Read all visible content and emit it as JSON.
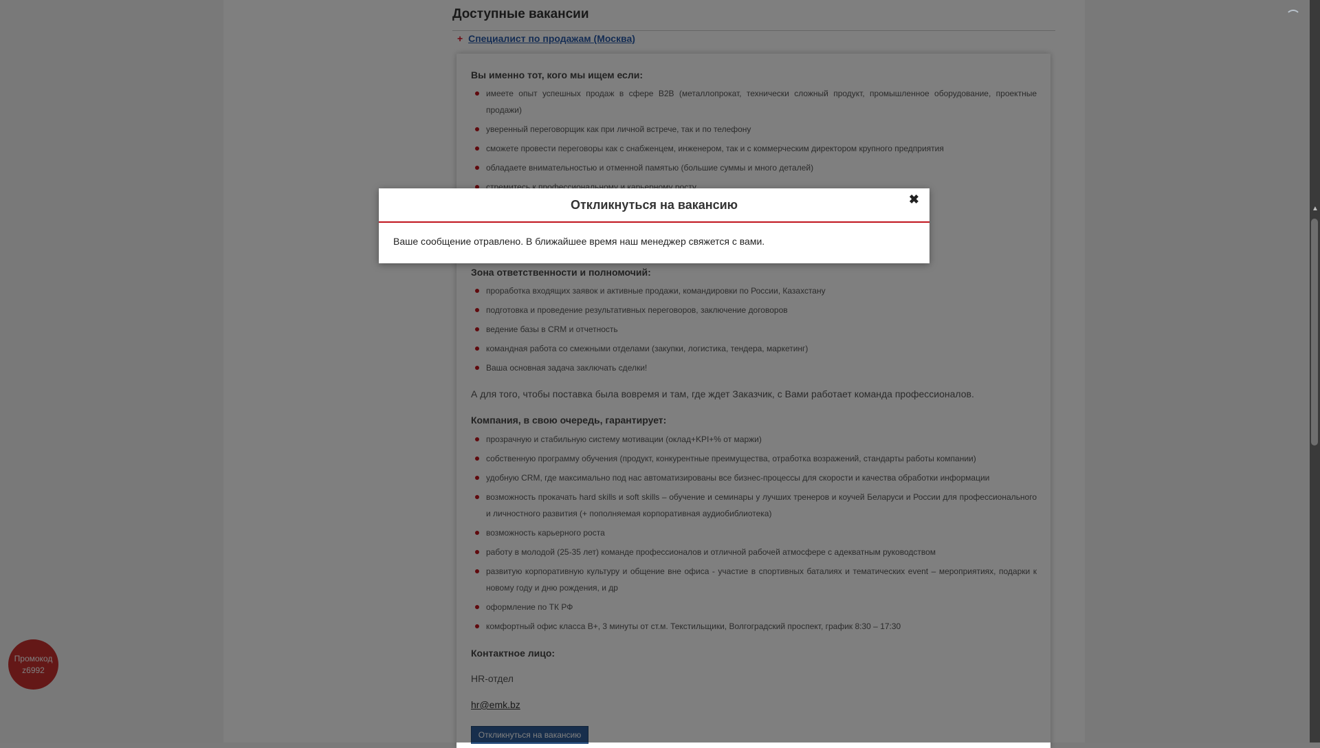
{
  "section": {
    "title": "Доступные вакансии"
  },
  "vacancy": {
    "toggle": "+",
    "title": "Специалист по продажам (Москва)",
    "who_heading": "Вы именно тот, кого мы ищем если:",
    "who_items": [
      "имеете опыт успешных продаж в сфере B2B (металлопрокат, технически сложный продукт, промышленное оборудование, проектные продажи)",
      "уверенный переговорщик как при личной встрече, так и по телефону",
      "сможете провести переговоры как с снабженцем, инженером, так и с коммерческим директором крупного предприятия",
      "обладаете внимательностью и отменной памятью (большие суммы и много деталей)",
      "стремитесь к профессиональному и карьерному росту"
    ],
    "resp_heading": "Зона ответственности и полномочий:",
    "resp_items": [
      "проработка входящих заявок и активные продажи, командировки по России, Казахстану",
      "подготовка и проведение результативных переговоров, заключение договоров",
      "ведение базы в CRM и отчетность",
      "командная работа со смежными отделами (закупки, логистика, тендера, маркетинг)",
      "Ваша основная задача заключать сделки!"
    ],
    "team_paragraph": "А для того, чтобы поставка была вовремя и там, где ждет Заказчик, с Вами работает команда профессионалов.",
    "company_heading": "Компания, в свою очередь, гарантирует:",
    "company_items": [
      "прозрачную и стабильную систему мотивации (оклад+KPI+% от маржи)",
      "собственную программу обучения (продукт, конкурентные преимущества, отработка возражений, стандарты работы компании)",
      "удобную CRM, где максимально под нас автоматизированы все бизнес-процессы для скорости и качества обработки информации",
      "возможность прокачать hard skills и soft skills – обучение и семинары у лучших тренеров и коучей Беларуси и России для профессионального и личностного развития (+ пополняемая корпоративная аудиобиблиотека)",
      "возможность карьерного роста",
      "работу в молодой (25-35 лет) команде профессионалов и отличной рабочей атмосфере с адекватным руководством",
      "развитую корпоративную культуру и общение вне офиса - участие в спортивных баталиях и тематических event – мероприятиях, подарки к новому году и дню рождения, и др",
      "оформление по ТК РФ",
      "комфортный офис класса B+, 3 минуты от ст.м. Текстильщики, Волгоградский проспект, график 8:30 – 17:30"
    ],
    "contact_heading": "Контактное лицо:",
    "contact_name": "HR-отдел",
    "contact_email": "hr@emk.bz",
    "apply_label": "Откликнуться на вакансию"
  },
  "promo": {
    "line1": "Промокод",
    "line2": "z6992"
  },
  "modal": {
    "title": "Откликнуться на вакансию",
    "close": "✖",
    "message": "Ваше сообщение отравлено. В ближайшее время наш менеджер свяжется с вами."
  },
  "colors": {
    "accent_red": "#c0141c",
    "link_blue": "#2a5ba8",
    "button_blue": "#2e5d98",
    "promo_red": "#c9312f"
  }
}
